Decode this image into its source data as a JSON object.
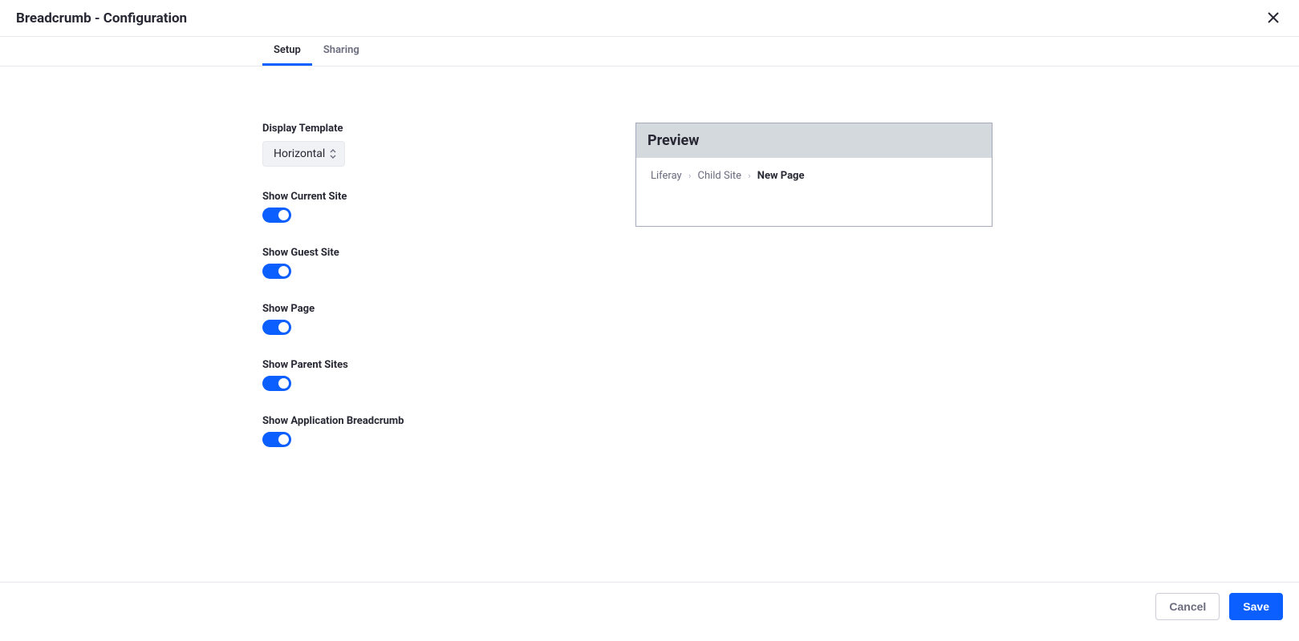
{
  "header": {
    "title": "Breadcrumb - Configuration"
  },
  "tabs": {
    "setup": "Setup",
    "sharing": "Sharing"
  },
  "form": {
    "displayTemplate": {
      "label": "Display Template",
      "value": "Horizontal"
    },
    "toggles": {
      "showCurrentSite": "Show Current Site",
      "showGuestSite": "Show Guest Site",
      "showPage": "Show Page",
      "showParentSites": "Show Parent Sites",
      "showApplicationBreadcrumb": "Show Application Breadcrumb"
    }
  },
  "preview": {
    "title": "Preview",
    "crumbs": {
      "item1": "Liferay",
      "item2": "Child Site",
      "item3": "New Page"
    }
  },
  "footer": {
    "cancel": "Cancel",
    "save": "Save"
  }
}
